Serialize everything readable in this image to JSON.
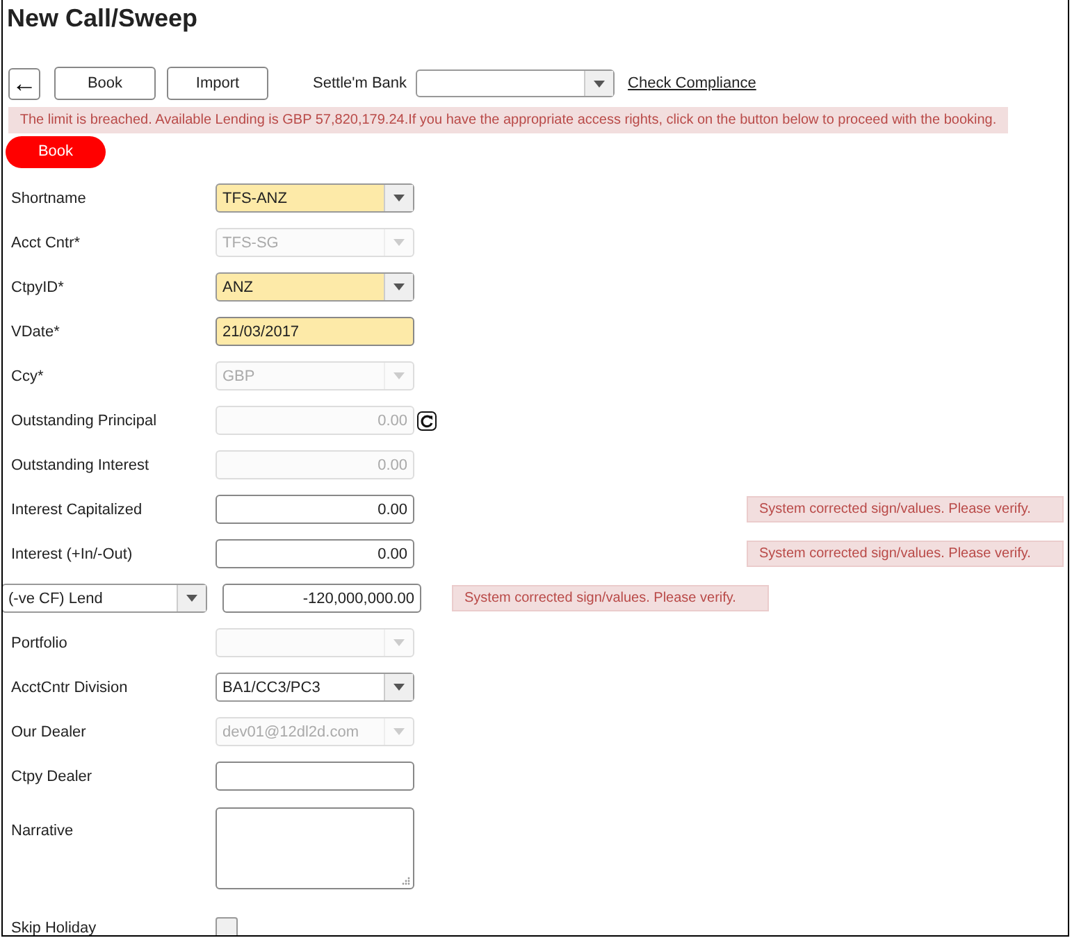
{
  "title": "New Call/Sweep",
  "toolbar": {
    "back_button": "←",
    "buttons": [
      "Book",
      "Import"
    ],
    "settle_bank": {
      "label": "Settle'm Bank"
    },
    "link": "Check Compliance"
  },
  "alert": "The limit is breached. Available Lending is GBP 57,820,179.24.If you have the appropriate access rights, click on the button below to proceed with the booking.",
  "book_button": "Book",
  "fields": [
    {
      "kind": "select",
      "label": "Shortname",
      "value": "TFS-ANZ",
      "highlighted": true,
      "disabled": false
    },
    {
      "kind": "select",
      "label": "Acct Cntr*",
      "value": "TFS-SG",
      "highlighted": false,
      "disabled": true
    },
    {
      "kind": "select",
      "label": "CtpyID*",
      "value": "ANZ",
      "highlighted": true,
      "disabled": false
    },
    {
      "kind": "text",
      "label": "VDate*",
      "value": "21/03/2017",
      "highlighted": true,
      "disabled": false
    },
    {
      "kind": "select",
      "label": "Ccy*",
      "value": "GBP",
      "highlighted": false,
      "disabled": true
    },
    {
      "kind": "number",
      "label": "Outstanding Principal",
      "value": "0.00",
      "highlighted": false,
      "disabled": true,
      "refresh": true
    },
    {
      "kind": "number",
      "label": "Outstanding Interest",
      "value": "0.00",
      "highlighted": false,
      "disabled": true
    },
    {
      "kind": "number",
      "label": "Interest Capitalized",
      "value": "0.00",
      "highlighted": false,
      "disabled": false,
      "warning": "System corrected sign/values. Please verify."
    },
    {
      "kind": "number",
      "label": "Interest (+In/-Out)",
      "value": "0.00",
      "highlighted": false,
      "disabled": false,
      "warning": "System corrected sign/values. Please verify."
    },
    {
      "kind": "label_select",
      "label": "(-ve CF) Lend",
      "value": "-120,000,000.00",
      "highlighted": false,
      "disabled": false,
      "warning": "System corrected sign/values. Please verify."
    },
    {
      "kind": "select",
      "label": "Portfolio",
      "highlighted": false,
      "disabled": true
    },
    {
      "kind": "select",
      "label": "AcctCntr Division",
      "value": "BA1/CC3/PC3",
      "highlighted": false,
      "disabled": false
    },
    {
      "kind": "select",
      "label": "Our Dealer",
      "value": "dev01@12dl2d.com",
      "highlighted": false,
      "disabled": true
    },
    {
      "kind": "text",
      "label": "Ctpy Dealer",
      "highlighted": false,
      "disabled": false
    },
    {
      "kind": "textarea",
      "label": "Narrative",
      "disabled": false
    },
    {
      "kind": "checkbox",
      "label": "Skip Holiday",
      "checked": false
    }
  ]
}
